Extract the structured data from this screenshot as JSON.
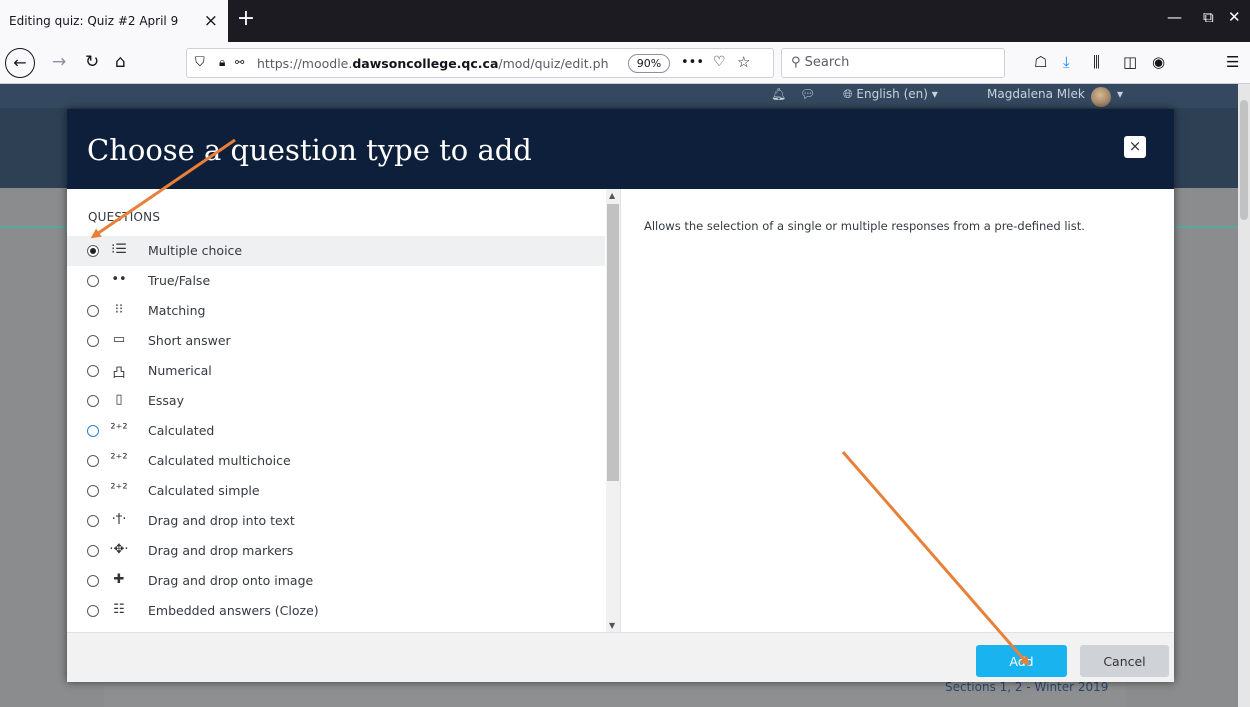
{
  "browser": {
    "tab_title": "Editing quiz: Quiz #2 April 9",
    "tab_close": "×",
    "new_tab": "+",
    "url_prefix": "https://moodle.",
    "url_domain": "dawsoncollege.qc.ca",
    "url_path": "/mod/quiz/edit.ph",
    "zoom": "90%",
    "search_placeholder": "Search",
    "window_controls": [
      "minimize-icon",
      "restore-icon",
      "close-icon"
    ]
  },
  "moodle_nav": {
    "language": "English (en)",
    "user_name": "Magdalena Mlek"
  },
  "modal": {
    "title": "Choose a question type to add",
    "close_label": "×",
    "section_title": "QUESTIONS",
    "question_types": [
      {
        "label": "Multiple choice",
        "icon": "multiple-choice-icon",
        "glyph": "⁝☰",
        "selected": true
      },
      {
        "label": "True/False",
        "icon": "true-false-icon",
        "glyph": "••",
        "selected": false
      },
      {
        "label": "Matching",
        "icon": "matching-icon",
        "glyph": "⁝⁝",
        "selected": false
      },
      {
        "label": "Short answer",
        "icon": "short-answer-icon",
        "glyph": "▭",
        "selected": false
      },
      {
        "label": "Numerical",
        "icon": "numerical-icon",
        "glyph": "凸",
        "selected": false
      },
      {
        "label": "Essay",
        "icon": "essay-icon",
        "glyph": "▯",
        "selected": false
      },
      {
        "label": "Calculated",
        "icon": "calculated-icon",
        "glyph": "²⁺²",
        "selected": false
      },
      {
        "label": "Calculated multichoice",
        "icon": "calculated-multichoice-icon",
        "glyph": "²⁺²",
        "selected": false
      },
      {
        "label": "Calculated simple",
        "icon": "calculated-simple-icon",
        "glyph": "²⁺²",
        "selected": false
      },
      {
        "label": "Drag and drop into text",
        "icon": "drag-drop-text-icon",
        "glyph": "·†·",
        "selected": false
      },
      {
        "label": "Drag and drop markers",
        "icon": "drag-drop-markers-icon",
        "glyph": "·✥·",
        "selected": false
      },
      {
        "label": "Drag and drop onto image",
        "icon": "drag-drop-image-icon",
        "glyph": "✚",
        "selected": false
      },
      {
        "label": "Embedded answers (Cloze)",
        "icon": "cloze-icon",
        "glyph": "☷",
        "selected": false
      }
    ],
    "description": "Allows the selection of a single or multiple responses from a pre-defined list.",
    "add_label": "Add",
    "cancel_label": "Cancel"
  },
  "background": {
    "link_text": "Sections 1, 2 - Winter 2019"
  },
  "colors": {
    "modal_header": "#0d1f3a",
    "add_button": "#19b4f0",
    "annotation_arrow": "#e8803a"
  }
}
